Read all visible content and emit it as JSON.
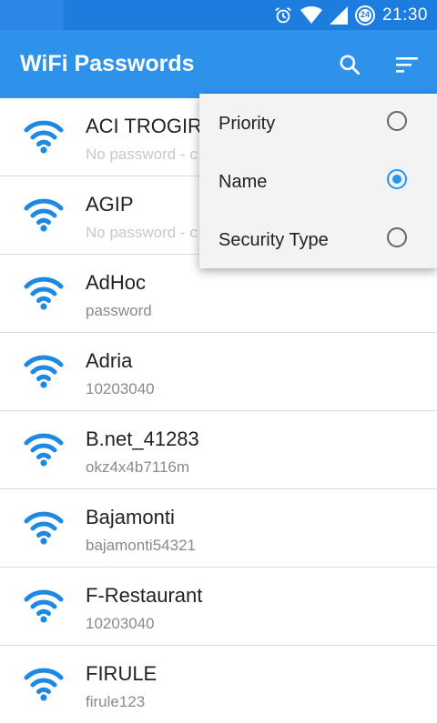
{
  "status_bar": {
    "time": "21:30",
    "badge": "24"
  },
  "app_bar": {
    "title": "WiFi Passwords",
    "accent": "#2e92ea"
  },
  "networks": [
    {
      "ssid": "ACI TROGIR",
      "password": "No password - c"
    },
    {
      "ssid": "AGIP",
      "password": "No password - c"
    },
    {
      "ssid": "AdHoc",
      "password": "password"
    },
    {
      "ssid": "Adria",
      "password": "10203040"
    },
    {
      "ssid": "B.net_41283",
      "password": "okz4x4b7116m"
    },
    {
      "ssid": "Bajamonti",
      "password": "bajamonti54321"
    },
    {
      "ssid": "F-Restaurant",
      "password": "10203040"
    },
    {
      "ssid": "FIRULE",
      "password": "firule123"
    }
  ],
  "sort_menu": {
    "options": [
      {
        "label": "Priority",
        "selected": false
      },
      {
        "label": "Name",
        "selected": true
      },
      {
        "label": "Security Type",
        "selected": false
      }
    ]
  }
}
